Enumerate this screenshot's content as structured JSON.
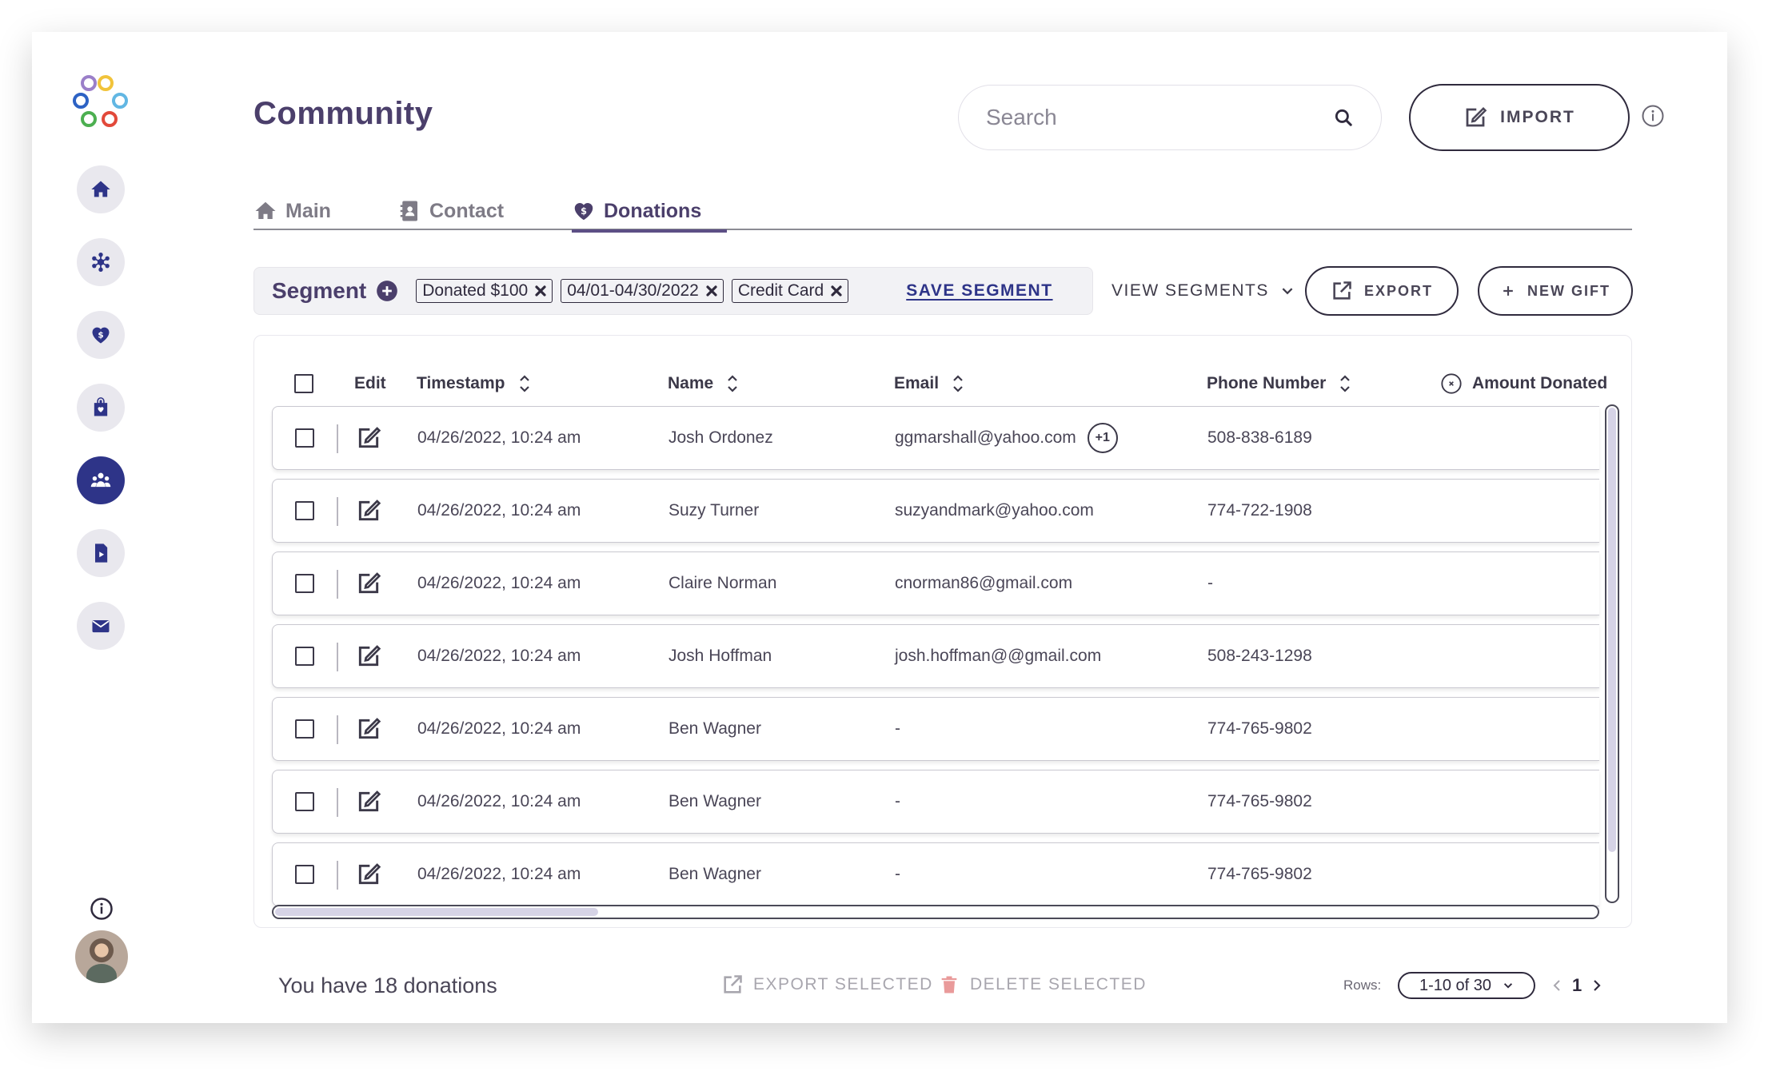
{
  "app": {
    "title": "Community"
  },
  "colors": {
    "accent": "#2e3488",
    "title": "#4b3f6b",
    "muted": "#a8a6ae"
  },
  "header": {
    "search_placeholder": "Search",
    "import_label": "IMPORT"
  },
  "tabs": [
    {
      "label": "Main",
      "icon": "home-icon",
      "active": false
    },
    {
      "label": "Contact",
      "icon": "contact-book-icon",
      "active": false
    },
    {
      "label": "Donations",
      "icon": "heart-dollar-icon",
      "active": true
    }
  ],
  "sidebar": {
    "items": [
      {
        "name": "home",
        "icon": "home-icon",
        "active": false
      },
      {
        "name": "network",
        "icon": "network-icon",
        "active": false
      },
      {
        "name": "donations",
        "icon": "heart-dollar-icon",
        "active": false
      },
      {
        "name": "volunteer",
        "icon": "heart-bag-icon",
        "active": false
      },
      {
        "name": "community",
        "icon": "people-icon",
        "active": true
      },
      {
        "name": "media",
        "icon": "video-file-icon",
        "active": false
      },
      {
        "name": "mail",
        "icon": "mail-icon",
        "active": false
      }
    ]
  },
  "segment": {
    "label": "Segment",
    "chips": [
      "Donated $100",
      "04/01-04/30/2022",
      "Credit Card"
    ],
    "save_label": "SAVE SEGMENT"
  },
  "toolbar": {
    "view_segments_label": "VIEW SEGMENTS",
    "export_label": "EXPORT",
    "new_gift_label": "NEW GIFT"
  },
  "table": {
    "headers": {
      "edit": "Edit",
      "timestamp": "Timestamp",
      "name": "Name",
      "email": "Email",
      "phone": "Phone Number",
      "amount": "Amount Donated"
    },
    "rows": [
      {
        "timestamp": "04/26/2022, 10:24 am",
        "name": "Josh Ordonez",
        "email": "ggmarshall@yahoo.com",
        "extra_emails": "+1",
        "phone": "508-838-6189"
      },
      {
        "timestamp": "04/26/2022, 10:24 am",
        "name": "Suzy Turner",
        "email": "suzyandmark@yahoo.com",
        "extra_emails": "",
        "phone": "774-722-1908"
      },
      {
        "timestamp": "04/26/2022, 10:24 am",
        "name": "Claire Norman",
        "email": "cnorman86@gmail.com",
        "extra_emails": "",
        "phone": "-"
      },
      {
        "timestamp": "04/26/2022, 10:24 am",
        "name": "Josh Hoffman",
        "email": "josh.hoffman@@gmail.com",
        "extra_emails": "",
        "phone": "508-243-1298"
      },
      {
        "timestamp": "04/26/2022, 10:24 am",
        "name": "Ben Wagner",
        "email": "-",
        "extra_emails": "",
        "phone": "774-765-9802"
      },
      {
        "timestamp": "04/26/2022, 10:24 am",
        "name": "Ben Wagner",
        "email": "-",
        "extra_emails": "",
        "phone": "774-765-9802"
      },
      {
        "timestamp": "04/26/2022, 10:24 am",
        "name": "Ben Wagner",
        "email": "-",
        "extra_emails": "",
        "phone": "774-765-9802"
      }
    ]
  },
  "footer": {
    "count_text": "You have 18 donations",
    "export_selected_label": "EXPORT SELECTED",
    "delete_selected_label": "DELETE SELECTED",
    "rows_label": "Rows:",
    "rows_value": "1-10 of 30",
    "current_page": "1"
  }
}
